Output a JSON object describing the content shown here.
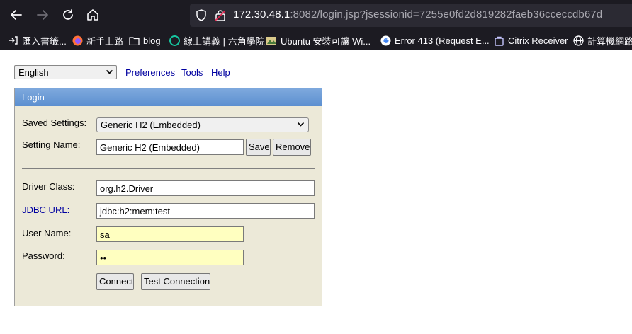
{
  "browser": {
    "url_host": "172.30.48.1",
    "url_rest": ":8082/login.jsp?jsessionid=7255e0fd2d819282faeb36cceccdb67d",
    "bookmarks": [
      {
        "icon": "import-icon",
        "label": "匯入書籤..."
      },
      {
        "icon": "firefox-icon",
        "label": "新手上路"
      },
      {
        "icon": "folder-icon",
        "label": "blog"
      },
      {
        "icon": "site-icon",
        "label": "線上講義 | 六角學院"
      },
      {
        "icon": "site-icon",
        "label": "Ubuntu 安裝可讓 Wi..."
      },
      {
        "icon": "google-icon",
        "label": "Error 413 (Request E..."
      },
      {
        "icon": "citrix-icon",
        "label": "Citrix Receiver"
      },
      {
        "icon": "globe-icon",
        "label": "計算機網路"
      }
    ]
  },
  "toolbar": {
    "language": "English",
    "preferences": "Preferences",
    "tools": "Tools",
    "help": "Help"
  },
  "login": {
    "title": "Login",
    "saved_settings_label": "Saved Settings:",
    "saved_settings_value": "Generic H2 (Embedded)",
    "setting_name_label": "Setting Name:",
    "setting_name_value": "Generic H2 (Embedded)",
    "save_button": "Save",
    "remove_button": "Remove",
    "driver_class_label": "Driver Class:",
    "driver_class_value": "org.h2.Driver",
    "jdbc_url_label": "JDBC URL:",
    "jdbc_url_value": "jdbc:h2:mem:test",
    "user_name_label": "User Name:",
    "user_name_value": "sa",
    "password_label": "Password:",
    "password_value": "••",
    "connect_button": "Connect",
    "test_connection_button": "Test Connection"
  },
  "colors": {
    "panel_bg": "#ece9d8",
    "panel_header": "#5c8fd0",
    "link": "#0000a0",
    "credential_field_bg": "#ffffc0"
  }
}
